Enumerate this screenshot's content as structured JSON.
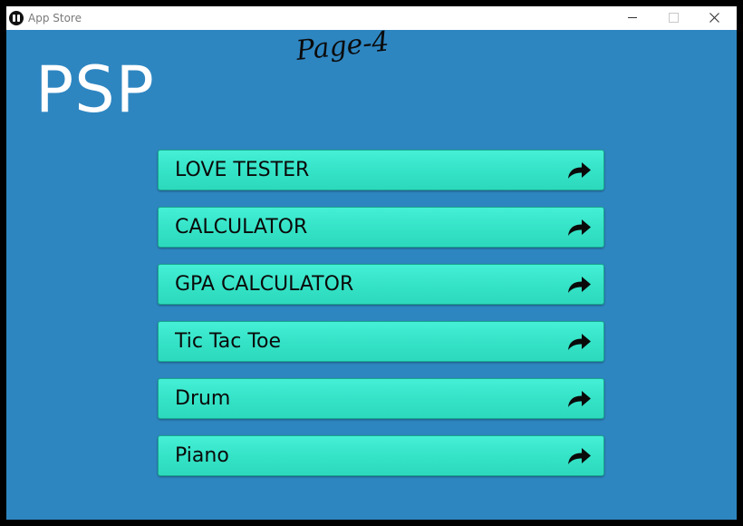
{
  "window": {
    "title": "App Store"
  },
  "header": {
    "brand": "PSP",
    "page_label": "Page-4"
  },
  "apps": [
    {
      "label": "LOVE TESTER",
      "icon": "share-arrow-icon"
    },
    {
      "label": "CALCULATOR",
      "icon": "share-arrow-icon"
    },
    {
      "label": "GPA CALCULATOR",
      "icon": "share-arrow-icon"
    },
    {
      "label": "Tic Tac Toe",
      "icon": "share-arrow-icon"
    },
    {
      "label": "Drum",
      "icon": "share-arrow-icon"
    },
    {
      "label": "Piano",
      "icon": "share-arrow-icon"
    }
  ],
  "colors": {
    "background": "#2e86c1",
    "button": "#34e2c6",
    "brand_text": "#ffffff"
  }
}
